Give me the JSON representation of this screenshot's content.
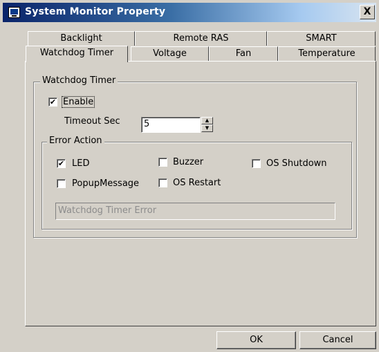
{
  "window": {
    "title": "System Monitor Property",
    "close_label": "X"
  },
  "tabs": {
    "row1": [
      "Backlight",
      "Remote RAS",
      "SMART"
    ],
    "row2": [
      "Watchdog Timer",
      "Voltage",
      "Fan",
      "Temperature"
    ],
    "active": "Watchdog Timer"
  },
  "watchdog": {
    "group_label": "Watchdog Timer",
    "enable_label": "Enable",
    "enable_checked": true,
    "timeout_label": "Timeout Sec",
    "timeout_value": "5",
    "spin_up": "▲",
    "spin_down": "▼",
    "error_action": {
      "group_label": "Error Action",
      "led": {
        "label": "LED",
        "checked": true
      },
      "buzzer": {
        "label": "Buzzer",
        "checked": false
      },
      "os_shutdown": {
        "label": "OS Shutdown",
        "checked": false
      },
      "popup_message": {
        "label": "PopupMessage",
        "checked": false
      },
      "os_restart": {
        "label": "OS Restart",
        "checked": false
      },
      "message_value": "Watchdog Timer Error"
    }
  },
  "buttons": {
    "ok": "OK",
    "cancel": "Cancel"
  },
  "checkmark": "✔"
}
